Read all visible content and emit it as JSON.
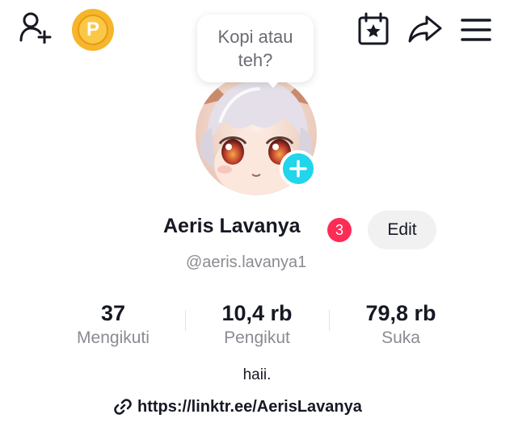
{
  "header": {
    "coin_letter": "P",
    "icons": [
      "add-friend-icon",
      "coin-icon",
      "calendar-star-icon",
      "share-icon",
      "menu-icon"
    ]
  },
  "bubble": {
    "text": "Kopi atau teh?"
  },
  "profile": {
    "name": "Aeris Lavanya",
    "badge_count": "3",
    "edit_label": "Edit",
    "username": "@aeris.lavanya1"
  },
  "stats": {
    "following": {
      "value": "37",
      "label": "Mengikuti"
    },
    "followers": {
      "value": "10,4 rb",
      "label": "Pengikut"
    },
    "likes": {
      "value": "79,8 rb",
      "label": "Suka"
    }
  },
  "bio": "haii.",
  "link": "https://linktr.ee/AerisLavanya",
  "colors": {
    "accent_red": "#fe2c55",
    "accent_cyan": "#20d5ec",
    "coin_gold": "#f6b52b",
    "text_primary": "#161823",
    "text_secondary": "#8a8b91"
  }
}
